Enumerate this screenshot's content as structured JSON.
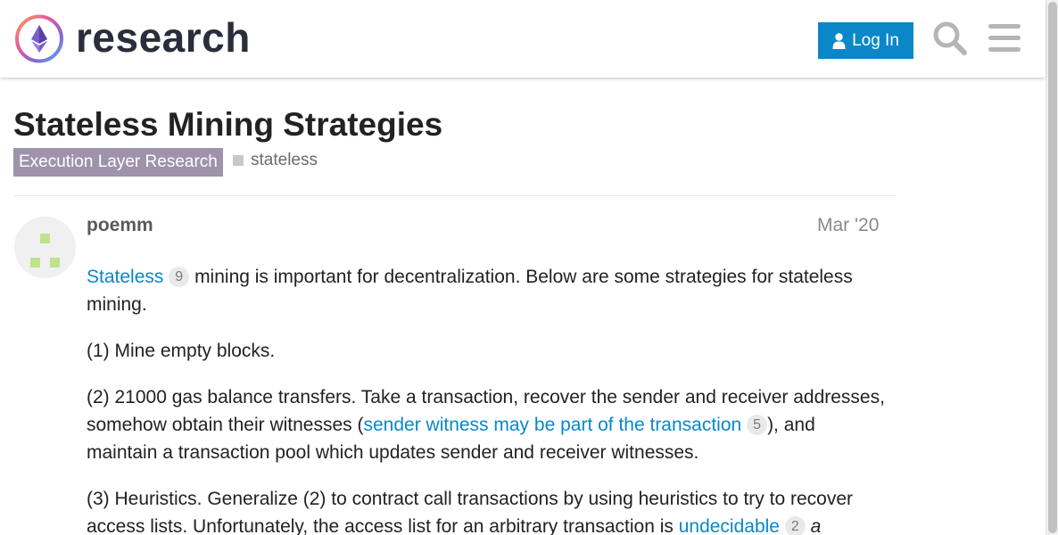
{
  "header": {
    "logo_text": "research",
    "login_label": "Log In"
  },
  "topic": {
    "title": "Stateless Mining Strategies",
    "category": "Execution Layer Research",
    "tag": "stateless",
    "colors": {
      "category_bg": "#9e93ab",
      "accent": "#0a87c9"
    }
  },
  "post": {
    "username": "poemm",
    "date": "Mar '20",
    "p1": {
      "link_text": "Stateless",
      "link_count": "9",
      "text": " mining is important for decentralization. Below are some strategies for stateless mining."
    },
    "p2": "(1) Mine empty blocks.",
    "p3": {
      "text_before": "(2) 21000 gas balance transfers. Take a transaction, recover the sender and receiver addresses, somehow obtain their witnesses (",
      "link_text": "sender witness may be part of the transaction",
      "link_count": "5",
      "text_after": "), and maintain a transaction pool which updates sender and receiver witnesses."
    },
    "p4": {
      "text_before": "(3) Heuristics. Generalize (2) to contract call transactions by using heuristics to try to recover access lists. Unfortunately, the access list for an arbitrary transaction is ",
      "link_text": "undecidable",
      "link_count": "2",
      "text_after": "a"
    }
  },
  "icons": {
    "login": "user-icon",
    "search": "search-icon",
    "menu": "hamburger-menu-icon",
    "logo": "ethereum-logo-icon"
  }
}
